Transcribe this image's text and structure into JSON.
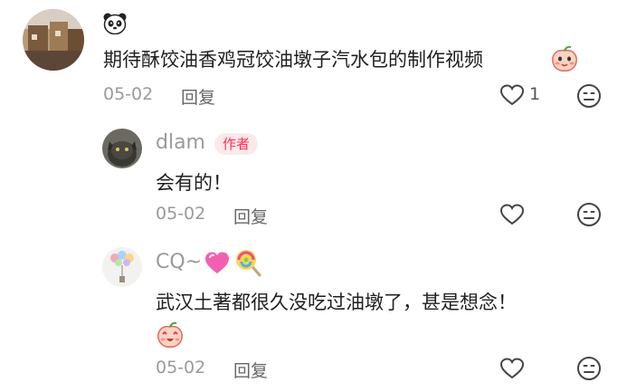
{
  "comments": [
    {
      "user": {
        "name": "",
        "name_icon": "panda-face-icon"
      },
      "text": "期待酥饺油香鸡冠饺油墩子汽水包的制作视频",
      "trailing_emoji": "peach-face-emoji-icon",
      "date": "05-02",
      "reply_label": "回复",
      "likes": "1"
    },
    {
      "user": {
        "name": "dlam",
        "badge": "作者"
      },
      "text": "会有的！",
      "date": "05-02",
      "reply_label": "回复"
    },
    {
      "user": {
        "name": "CQ~",
        "name_icons": [
          "pink-heart-icon",
          "lollipop-icon"
        ]
      },
      "text": "武汉土著都很久没吃过油墩了，甚是想念！",
      "extra_emoji": "peach-face-emoji-icon",
      "date": "05-02",
      "reply_label": "回复"
    }
  ]
}
